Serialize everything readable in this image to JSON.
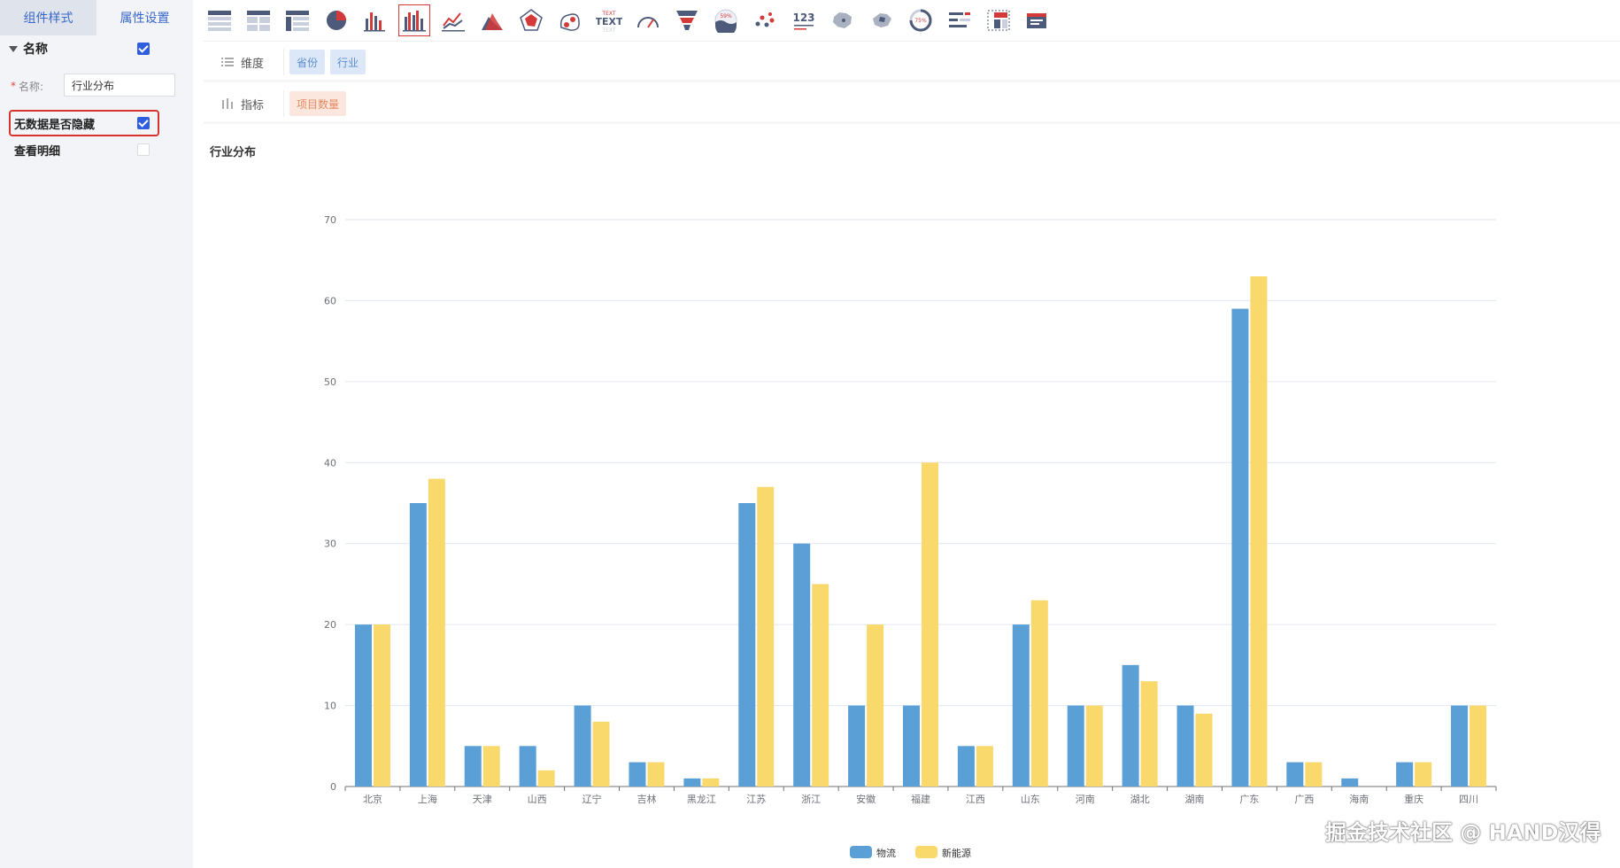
{
  "left_panel": {
    "tabs": [
      "组件样式",
      "属性设置"
    ],
    "section_title": "名称",
    "name_label": "名称:",
    "name_value": "行业分布",
    "options": [
      {
        "label": "无数据是否隐藏",
        "checked": true
      },
      {
        "label": "查看明细",
        "checked": false
      }
    ]
  },
  "toolbar": {
    "icons": [
      "table-icon",
      "table-header-icon",
      "pivot-table-icon",
      "pie-chart-icon",
      "bar-chart-icon",
      "grouped-bar-chart-icon",
      "line-chart-icon",
      "area-chart-icon",
      "radar-chart-icon",
      "bubble-chart-icon",
      "text-icon",
      "gauge-icon",
      "funnel-icon",
      "liquid-fill-icon",
      "scatter-icon",
      "number-card-icon",
      "china-map-icon",
      "map-icon",
      "progress-ring-icon",
      "bar-list-icon",
      "matrix-icon",
      "card-icon"
    ],
    "selected_index": 5,
    "text_icon_label": "TEXT",
    "number_icon_label": "123",
    "liquid_label": "59%",
    "progress_label": "75%"
  },
  "shelves": {
    "dimension_label": "维度",
    "dimensions": [
      "省份",
      "行业"
    ],
    "measure_label": "指标",
    "measures": [
      "项目数量"
    ]
  },
  "chart_data": {
    "type": "bar",
    "title": "行业分布",
    "categories": [
      "北京",
      "上海",
      "天津",
      "山西",
      "辽宁",
      "吉林",
      "黑龙江",
      "江苏",
      "浙江",
      "安徽",
      "福建",
      "江西",
      "山东",
      "河南",
      "湖北",
      "湖南",
      "广东",
      "广西",
      "海南",
      "重庆",
      "四川"
    ],
    "series": [
      {
        "name": "物流",
        "color": "#5a9fd5",
        "values": [
          20,
          35,
          5,
          5,
          10,
          3,
          1,
          35,
          30,
          10,
          10,
          5,
          20,
          10,
          15,
          10,
          59,
          3,
          1,
          3,
          10
        ]
      },
      {
        "name": "新能源",
        "color": "#f9d96c",
        "values": [
          20,
          38,
          5,
          2,
          8,
          3,
          1,
          37,
          25,
          20,
          40,
          5,
          23,
          10,
          13,
          9,
          63,
          3,
          0,
          3,
          10
        ]
      }
    ],
    "ylim": [
      0,
      70
    ],
    "yticks": [
      0,
      10,
      20,
      30,
      40,
      50,
      60,
      70
    ],
    "grid": true,
    "legend_position": "bottom-center"
  },
  "watermark": "掘金技术社区 @ HAND汉得"
}
